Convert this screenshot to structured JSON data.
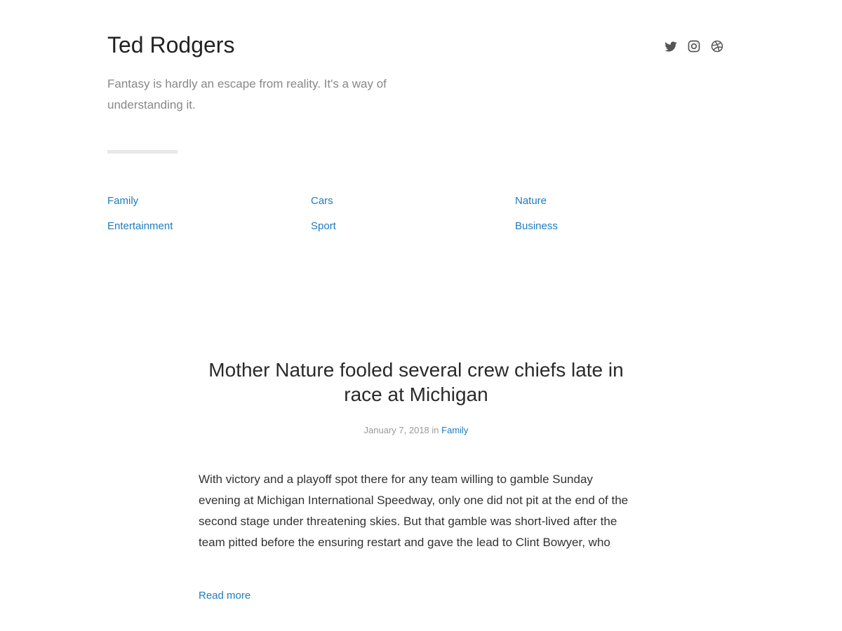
{
  "header": {
    "site_title": "Ted Rodgers",
    "tagline": "Fantasy is hardly an escape from reality. It's a way of understanding it.",
    "social": [
      {
        "name": "Twitter",
        "icon": "twitter-icon"
      },
      {
        "name": "Instagram",
        "icon": "instagram-icon"
      },
      {
        "name": "Dribbble",
        "icon": "dribbble-icon"
      }
    ]
  },
  "categories": [
    "Family",
    "Cars",
    "Nature",
    "Entertainment",
    "Sport",
    "Business"
  ],
  "post": {
    "title": "Mother Nature fooled several crew chiefs late in race at Michigan",
    "date": "January 7, 2018",
    "in_label": "in",
    "category": "Family",
    "excerpt": "With victory and a playoff spot there for any team willing to gamble Sunday evening at Michigan International Speedway, only one did not pit at the end of the second stage under threatening skies. But that gamble was short-lived after the team pitted before the ensuring restart and gave the lead to Clint Bowyer, who",
    "read_more": "Read more"
  },
  "colors": {
    "link": "#1f7bbf",
    "text": "#333333",
    "muted": "#888888",
    "icon": "#555555"
  }
}
